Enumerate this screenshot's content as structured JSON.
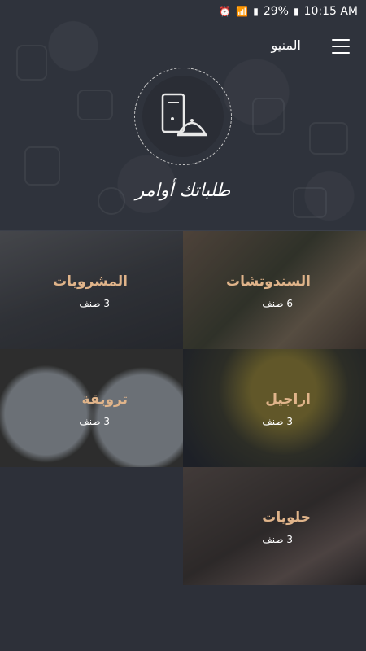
{
  "status_bar": {
    "battery": "29%",
    "time": "10:15 AM"
  },
  "header": {
    "title": "المنيو",
    "brand": "طلباتك أوامر"
  },
  "categories": [
    {
      "name": "السندوتشات",
      "count": "6 صنف"
    },
    {
      "name": "المشروبات",
      "count": "3 صنف"
    },
    {
      "name": "اراجيل",
      "count": "3 صنف"
    },
    {
      "name": "ترويقة",
      "count": "3 صنف"
    },
    {
      "name": "حلويات",
      "count": "3 صنف"
    }
  ],
  "colors": {
    "background": "#2d3039",
    "accent": "#e0b48a"
  }
}
